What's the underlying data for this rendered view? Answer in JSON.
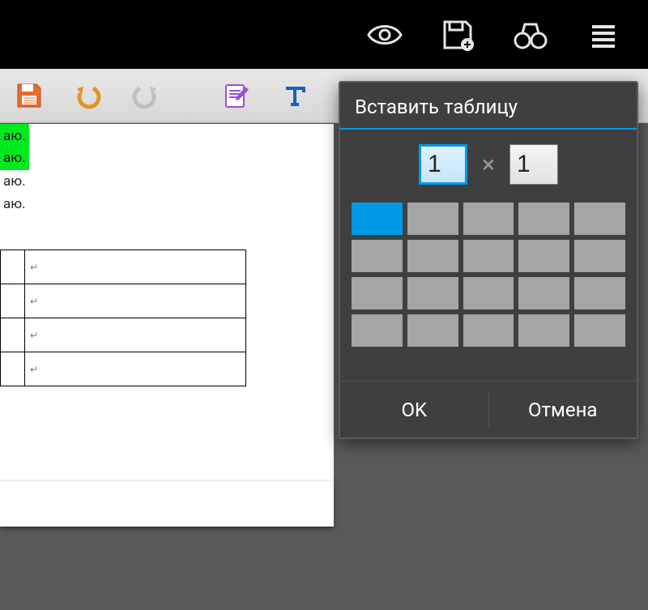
{
  "topbar": {
    "icons": [
      "eye-icon",
      "save-plus-icon",
      "binoculars-icon",
      "menu-icon"
    ]
  },
  "toolbar": {
    "items": [
      "save-icon",
      "undo-icon",
      "redo-icon",
      "edit-icon",
      "text-icon"
    ]
  },
  "document": {
    "lines": [
      {
        "text": "аю.",
        "highlight": true
      },
      {
        "text": "аю.",
        "highlight": true
      },
      {
        "text": "аю.",
        "highlight": false
      },
      {
        "text": "аю.",
        "highlight": false
      }
    ],
    "table_rows": 4,
    "cell_mark": "↵"
  },
  "dialog": {
    "title": "Вставить таблицу",
    "rows_value": "1",
    "cols_value": "1",
    "multiply_glyph": "×",
    "grid": {
      "rows": 4,
      "cols": 5,
      "selected": [
        0,
        0
      ]
    },
    "ok_label": "OK",
    "cancel_label": "Отмена"
  },
  "colors": {
    "accent": "#0099e5",
    "highlight": "#00eb1f",
    "dialog_bg": "#3f3f3f"
  }
}
